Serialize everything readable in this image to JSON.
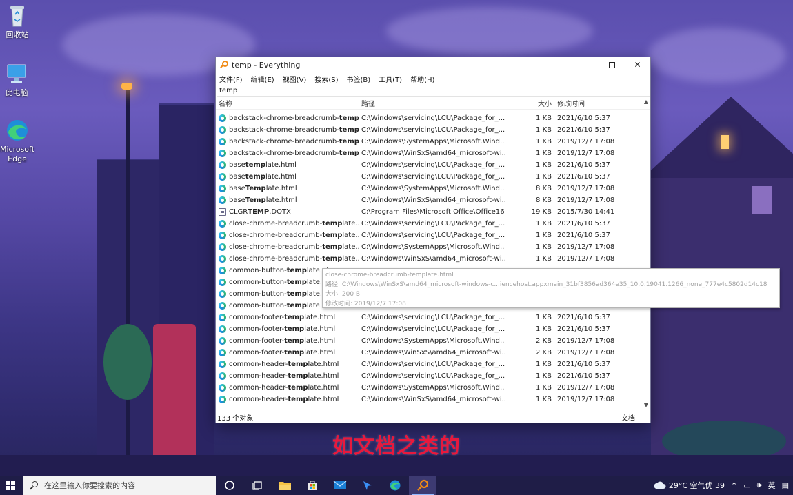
{
  "desktop": {
    "icons": [
      {
        "label": "回收站",
        "icon": "recycle-bin-icon"
      },
      {
        "label": "此电脑",
        "icon": "this-pc-icon"
      },
      {
        "label": "Microsoft Edge",
        "icon": "edge-icon"
      }
    ]
  },
  "window": {
    "title": "temp - Everything",
    "controls": {
      "minimize": "minimize-icon",
      "maximize": "maximize-icon",
      "close": "✕"
    },
    "menu": [
      "文件(F)",
      "编辑(E)",
      "视图(V)",
      "搜索(S)",
      "书签(B)",
      "工具(T)",
      "帮助(H)"
    ],
    "search_value": "temp",
    "columns": {
      "name": "名称",
      "path": "路径",
      "size": "大小",
      "date": "修改时间"
    },
    "rows": [
      {
        "pre": "backstack-chrome-breadcrumb-",
        "hl": "temp",
        "post": "...",
        "path": "C:\\Windows\\servicing\\LCU\\Package_for_...",
        "size": "1 KB",
        "date": "2021/6/10 5:37",
        "icon": "edge-html-icon"
      },
      {
        "pre": "backstack-chrome-breadcrumb-",
        "hl": "temp",
        "post": "...",
        "path": "C:\\Windows\\servicing\\LCU\\Package_for_...",
        "size": "1 KB",
        "date": "2021/6/10 5:37",
        "icon": "edge-html-icon"
      },
      {
        "pre": "backstack-chrome-breadcrumb-",
        "hl": "temp",
        "post": "...",
        "path": "C:\\Windows\\SystemApps\\Microsoft.Wind...",
        "size": "1 KB",
        "date": "2019/12/7 17:08",
        "icon": "edge-html-icon"
      },
      {
        "pre": "backstack-chrome-breadcrumb-",
        "hl": "temp",
        "post": "...",
        "path": "C:\\Windows\\WinSxS\\amd64_microsoft-wi...",
        "size": "1 KB",
        "date": "2019/12/7 17:08",
        "icon": "edge-html-icon"
      },
      {
        "pre": "base",
        "hl": "temp",
        "post": "late.html",
        "path": "C:\\Windows\\servicing\\LCU\\Package_for_...",
        "size": "1 KB",
        "date": "2021/6/10 5:37",
        "icon": "edge-html-icon"
      },
      {
        "pre": "base",
        "hl": "temp",
        "post": "late.html",
        "path": "C:\\Windows\\servicing\\LCU\\Package_for_...",
        "size": "1 KB",
        "date": "2021/6/10 5:37",
        "icon": "edge-html-icon"
      },
      {
        "pre": "base",
        "hl": "Temp",
        "post": "late.html",
        "path": "C:\\Windows\\SystemApps\\Microsoft.Wind...",
        "size": "8 KB",
        "date": "2019/12/7 17:08",
        "icon": "edge-html-icon"
      },
      {
        "pre": "base",
        "hl": "Temp",
        "post": "late.html",
        "path": "C:\\Windows\\WinSxS\\amd64_microsoft-wi...",
        "size": "8 KB",
        "date": "2019/12/7 17:08",
        "icon": "edge-html-icon"
      },
      {
        "pre": "CLGR",
        "hl": "TEMP",
        "post": ".DOTX",
        "path": "C:\\Program Files\\Microsoft Office\\Office16",
        "size": "19 KB",
        "date": "2015/7/30 14:41",
        "icon": "document-icon"
      },
      {
        "pre": "close-chrome-breadcrumb-",
        "hl": "temp",
        "post": "late....",
        "path": "C:\\Windows\\servicing\\LCU\\Package_for_...",
        "size": "1 KB",
        "date": "2021/6/10 5:37",
        "icon": "edge-html-icon"
      },
      {
        "pre": "close-chrome-breadcrumb-",
        "hl": "temp",
        "post": "late....",
        "path": "C:\\Windows\\servicing\\LCU\\Package_for_...",
        "size": "1 KB",
        "date": "2021/6/10 5:37",
        "icon": "edge-html-icon"
      },
      {
        "pre": "close-chrome-breadcrumb-",
        "hl": "temp",
        "post": "late....",
        "path": "C:\\Windows\\SystemApps\\Microsoft.Wind...",
        "size": "1 KB",
        "date": "2019/12/7 17:08",
        "icon": "edge-html-icon"
      },
      {
        "pre": "close-chrome-breadcrumb-",
        "hl": "temp",
        "post": "late....",
        "path": "C:\\Windows\\WinSxS\\amd64_microsoft-wi...",
        "size": "1 KB",
        "date": "2019/12/7 17:08",
        "icon": "edge-html-icon"
      },
      {
        "pre": "common-button-",
        "hl": "temp",
        "post": "late.ht",
        "path": "",
        "size": "",
        "date": "",
        "icon": "edge-html-icon"
      },
      {
        "pre": "common-button-",
        "hl": "temp",
        "post": "late.ht",
        "path": "",
        "size": "",
        "date": "",
        "icon": "edge-html-icon"
      },
      {
        "pre": "common-button-",
        "hl": "temp",
        "post": "late.ht",
        "path": "",
        "size": "",
        "date": "",
        "icon": "edge-html-icon"
      },
      {
        "pre": "common-button-",
        "hl": "temp",
        "post": "late.ht",
        "path": "",
        "size": "",
        "date": "",
        "icon": "edge-html-icon"
      },
      {
        "pre": "common-footer-",
        "hl": "temp",
        "post": "late.html",
        "path": "C:\\Windows\\servicing\\LCU\\Package_for_...",
        "size": "1 KB",
        "date": "2021/6/10 5:37",
        "icon": "edge-html-icon"
      },
      {
        "pre": "common-footer-",
        "hl": "temp",
        "post": "late.html",
        "path": "C:\\Windows\\servicing\\LCU\\Package_for_...",
        "size": "1 KB",
        "date": "2021/6/10 5:37",
        "icon": "edge-html-icon"
      },
      {
        "pre": "common-footer-",
        "hl": "temp",
        "post": "late.html",
        "path": "C:\\Windows\\SystemApps\\Microsoft.Wind...",
        "size": "2 KB",
        "date": "2019/12/7 17:08",
        "icon": "edge-html-icon"
      },
      {
        "pre": "common-footer-",
        "hl": "temp",
        "post": "late.html",
        "path": "C:\\Windows\\WinSxS\\amd64_microsoft-wi...",
        "size": "2 KB",
        "date": "2019/12/7 17:08",
        "icon": "edge-html-icon"
      },
      {
        "pre": "common-header-",
        "hl": "temp",
        "post": "late.html",
        "path": "C:\\Windows\\servicing\\LCU\\Package_for_...",
        "size": "1 KB",
        "date": "2021/6/10 5:37",
        "icon": "edge-html-icon"
      },
      {
        "pre": "common-header-",
        "hl": "temp",
        "post": "late.html",
        "path": "C:\\Windows\\servicing\\LCU\\Package_for_...",
        "size": "1 KB",
        "date": "2021/6/10 5:37",
        "icon": "edge-html-icon"
      },
      {
        "pre": "common-header-",
        "hl": "temp",
        "post": "late.html",
        "path": "C:\\Windows\\SystemApps\\Microsoft.Wind...",
        "size": "1 KB",
        "date": "2019/12/7 17:08",
        "icon": "edge-html-icon"
      },
      {
        "pre": "common-header-",
        "hl": "temp",
        "post": "late.html",
        "path": "C:\\Windows\\WinSxS\\amd64_microsoft-wi...",
        "size": "1 KB",
        "date": "2019/12/7 17:08",
        "icon": "edge-html-icon"
      }
    ],
    "status": {
      "count": "133 个对象",
      "right": "文档"
    }
  },
  "tooltip": {
    "name": "close-chrome-breadcrumb-template.html",
    "path": "路径: C:\\Windows\\WinSxS\\amd64_microsoft-windows-c...iencehost.appxmain_31bf3856ad364e35_10.0.19041.1266_none_777e4c5802d14c18",
    "size": "大小: 200 B",
    "date": "修改时间: 2019/12/7 17:08"
  },
  "subtitle": "如文档之类的",
  "taskbar": {
    "search_placeholder": "在这里输入你要搜索的内容",
    "apps": [
      "cortana-icon",
      "task-view-icon",
      "file-explorer-icon",
      "store-icon",
      "mail-icon",
      "feishu-icon",
      "edge-icon",
      "everything-icon"
    ],
    "weather": "29°C 空气优 39",
    "ime": "英",
    "colors": {
      "taskbar": "#1f1d47",
      "active": "#3d3a72"
    }
  },
  "colors": {
    "subtitle": "#e8193d",
    "everything_orange": "#f08a15"
  }
}
